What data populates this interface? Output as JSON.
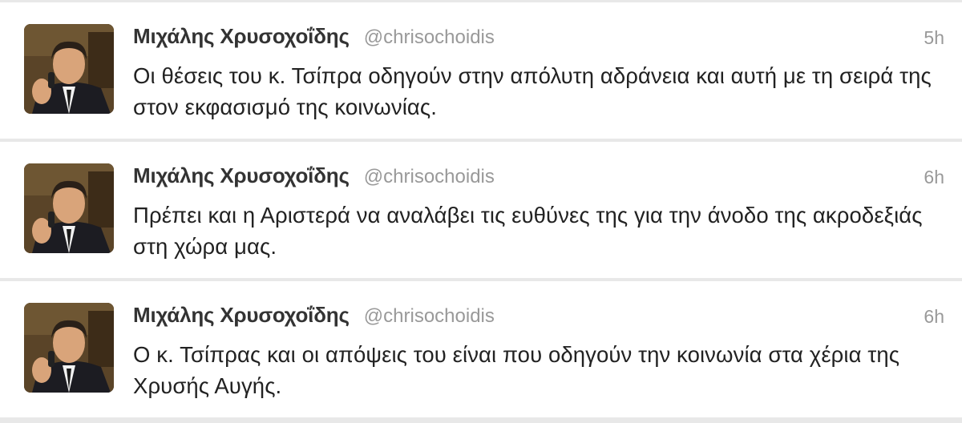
{
  "tweets": [
    {
      "name": "Μιχάλης Χρυσοχοΐδης",
      "handle": "@chrisochoidis",
      "time": "5h",
      "text": "Οι θέσεις του κ. Τσίπρα οδηγούν στην απόλυτη αδράνεια και αυτή με τη σειρά της στον εκφασισμό της κοινωνίας."
    },
    {
      "name": "Μιχάλης Χρυσοχοΐδης",
      "handle": "@chrisochoidis",
      "time": "6h",
      "text": "Πρέπει και η Αριστερά να αναλάβει τις ευθύνες της για την άνοδο της ακροδεξιάς στη χώρα μας."
    },
    {
      "name": "Μιχάλης Χρυσοχοΐδης",
      "handle": "@chrisochoidis",
      "time": "6h",
      "text": "Ο κ. Τσίπρας και οι απόψεις του είναι που οδηγούν την κοινωνία στα χέρια της Χρυσής Αυγής."
    }
  ],
  "colors": {
    "name": "#333333",
    "meta": "#999999",
    "text": "#222222",
    "divider": "#e8e8e8"
  }
}
